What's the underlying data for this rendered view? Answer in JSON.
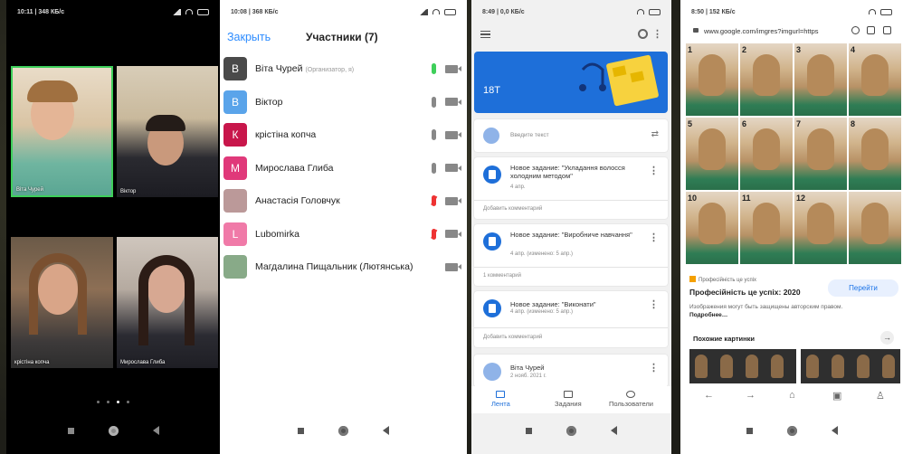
{
  "phone1": {
    "status_time": "10:11 | 348 КБ/с",
    "tiles": [
      {
        "label": "Віта Чурей"
      },
      {
        "label": "Віктор"
      },
      {
        "label": "крістіна копча"
      },
      {
        "label": "Мирослава Глиба"
      }
    ],
    "page_dots": 4,
    "active_dot": 2
  },
  "phone2": {
    "status_time": "10:08 | 368 КБ/с",
    "close_label": "Закрыть",
    "title": "Участники (7)",
    "participants": [
      {
        "initial": "В",
        "name": "Віта Чурей",
        "note": "(Организатор, я)",
        "color": "#4a4a4a",
        "mic": "on"
      },
      {
        "initial": "В",
        "name": "Віктор",
        "note": "",
        "color": "#5aa4ea",
        "mic": "off"
      },
      {
        "initial": "К",
        "name": "крістіна копча",
        "note": "",
        "color": "#c8164b",
        "mic": "off"
      },
      {
        "initial": "М",
        "name": "Мирослава Глиба",
        "note": "",
        "color": "#e0397a",
        "mic": "off"
      },
      {
        "initial": "",
        "name": "Анастасія Головчук",
        "note": "",
        "color": "#b99",
        "mic": "muted"
      },
      {
        "initial": "L",
        "name": "Lubomirka",
        "note": "",
        "color": "#f07aa8",
        "mic": "muted"
      },
      {
        "initial": "",
        "name": "Магдалина Пищальник (Лютянська)",
        "note": "",
        "color": "#8a8",
        "mic": "none"
      }
    ],
    "colors": {
      "accent": "#2d8cff",
      "mic_on": "#3ecf5a",
      "muted": "#e33"
    }
  },
  "phone3": {
    "status_time": "8:49 | 0,0 КБ/с",
    "class_name": "18Т",
    "composer_placeholder": "Введите текст",
    "posts": [
      {
        "title": "Новое задание: \"Укладання волосся холодним методом\"",
        "date": "4 апр.",
        "comment": "Добавить комментарий"
      },
      {
        "title": "Новое задание: \"Виробниче навчання\"",
        "date": "4 апр. (изменено: 5 апр.)",
        "comment": "1 комментарий"
      },
      {
        "title": "Новое задание: \"Виконати\"",
        "date": "4 апр. (изменено: 5 апр.)",
        "comment": "Добавить комментарий"
      },
      {
        "title": "Віта Чурей",
        "date": "2 нояб. 2021 г.",
        "comment": ""
      }
    ],
    "bottom_nav": [
      {
        "label": "Лента",
        "active": true
      },
      {
        "label": "Задания",
        "active": false
      },
      {
        "label": "Пользователи",
        "active": false
      }
    ],
    "colors": {
      "accent": "#1e6fd9"
    }
  },
  "phone4": {
    "status_time": "8:50 | 152 КБ/с",
    "url": "www.google.com/imgres?imgurl=https",
    "grid_numbers": [
      "1",
      "2",
      "3",
      "4",
      "5",
      "6",
      "7",
      "8",
      "10",
      "11",
      "12",
      ""
    ],
    "source": "Професійність це успіх",
    "page_title": "Професійність це успіх: 2020",
    "visit_label": "Перейти",
    "warning": "Изображения могут быть защищены авторским правом.",
    "warning_more": "Подробнее…",
    "similar_label": "Похожие картинки"
  }
}
